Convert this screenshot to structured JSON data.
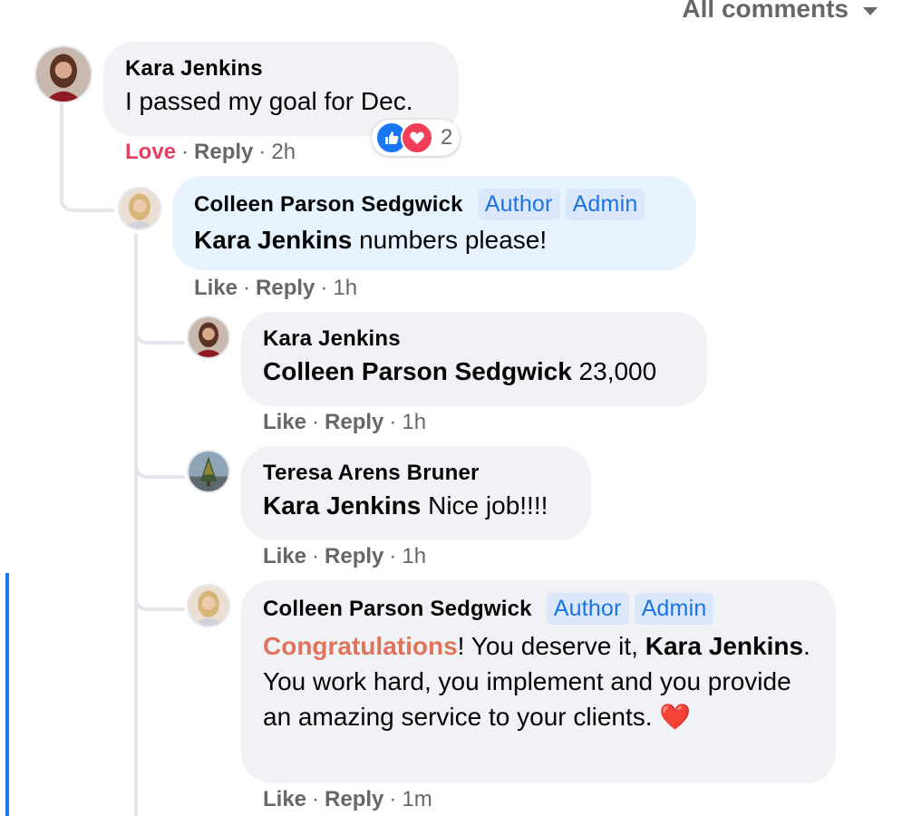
{
  "header": {
    "filter_label": "All comments"
  },
  "colors": {
    "accent": "#1877f2",
    "love": "#e4405f",
    "badge_text": "#1b74e4",
    "congrats": "#e0735c"
  },
  "comments": [
    {
      "author": "Kara Jenkins",
      "text": "I passed my goal for Dec.",
      "reaction_label": "Love",
      "reply_label": "Reply",
      "time": "2h",
      "reactions": {
        "icons": [
          "like-icon",
          "heart-icon"
        ],
        "count": "2"
      }
    },
    {
      "author": "Colleen Parson Sedgwick",
      "badges": [
        "Author",
        "Admin"
      ],
      "mention": "Kara Jenkins",
      "text": " numbers please!",
      "like_label": "Like",
      "reply_label": "Reply",
      "time": "1h"
    },
    {
      "author": "Kara Jenkins",
      "mention": "Colleen Parson Sedgwick",
      "text": " 23,000",
      "like_label": "Like",
      "reply_label": "Reply",
      "time": "1h"
    },
    {
      "author": "Teresa Arens Bruner",
      "mention": "Kara Jenkins",
      "text": " Nice job!!!!",
      "like_label": "Like",
      "reply_label": "Reply",
      "time": "1h"
    },
    {
      "author": "Colleen Parson Sedgwick",
      "badges": [
        "Author",
        "Admin"
      ],
      "highlight": "Congratulations",
      "text_1": "! You deserve it, ",
      "mention": "Kara Jenkins",
      "text_2": ". You work hard, you implement and you provide an amazing service to your clients. ",
      "emoji": "❤️",
      "like_label": "Like",
      "reply_label": "Reply",
      "time": "1m"
    }
  ]
}
